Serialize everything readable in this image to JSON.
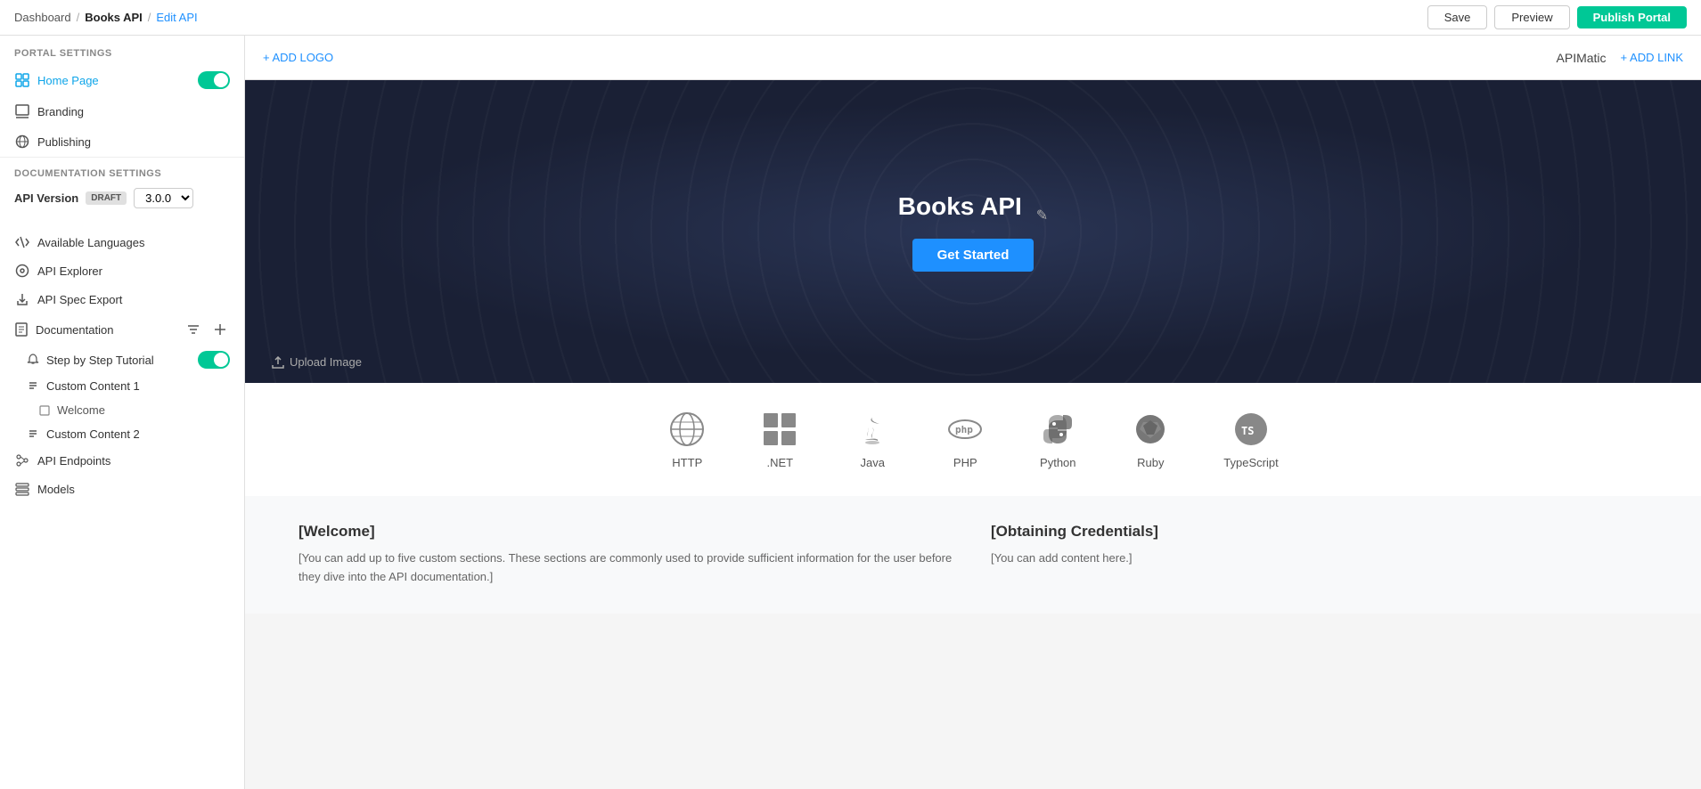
{
  "topNav": {
    "dashboard": "Dashboard",
    "booksApi": "Books API",
    "editApi": "Edit API",
    "save": "Save",
    "preview": "Preview",
    "publishPortal": "Publish Portal"
  },
  "sidebar": {
    "portalSettings": "PORTAL SETTINGS",
    "homePage": "Home Page",
    "branding": "Branding",
    "publishing": "Publishing",
    "documentationSettings": "DOCUMENTATION SETTINGS",
    "apiVersion": "API Version",
    "draftBadge": "DRAFT",
    "versionValue": "3.0.0",
    "availableLanguages": "Available Languages",
    "apiExplorer": "API Explorer",
    "apiSpecExport": "API Spec Export",
    "documentation": "Documentation",
    "stepByStepTutorial": "Step by Step Tutorial",
    "customContent1": "Custom Content 1",
    "welcome": "Welcome",
    "customContent2": "Custom Content 2",
    "apiEndpoints": "API Endpoints",
    "models": "Models"
  },
  "portalHeader": {
    "addLogo": "+ ADD LOGO",
    "portalName": "APIMatic",
    "addLink": "+ ADD LINK"
  },
  "hero": {
    "title": "Books API",
    "getStarted": "Get Started",
    "uploadImage": "Upload Image",
    "editIcon": "✎"
  },
  "languages": [
    {
      "name": "HTTP",
      "icon": "🌐"
    },
    {
      "name": ".NET",
      "icon": "⊞"
    },
    {
      "name": "Java",
      "icon": "☕"
    },
    {
      "name": "PHP",
      "icon": "php"
    },
    {
      "name": "Python",
      "icon": "🐍"
    },
    {
      "name": "Ruby",
      "icon": "💎"
    },
    {
      "name": "TypeScript",
      "icon": "TS"
    }
  ],
  "contentBlocks": [
    {
      "title": "[Welcome]",
      "body": "[You can add up to five custom sections. These sections are commonly used to provide sufficient information for the user before they dive into the API documentation.]"
    },
    {
      "title": "[Obtaining Credentials]",
      "body": "[You can add content here.]"
    }
  ]
}
